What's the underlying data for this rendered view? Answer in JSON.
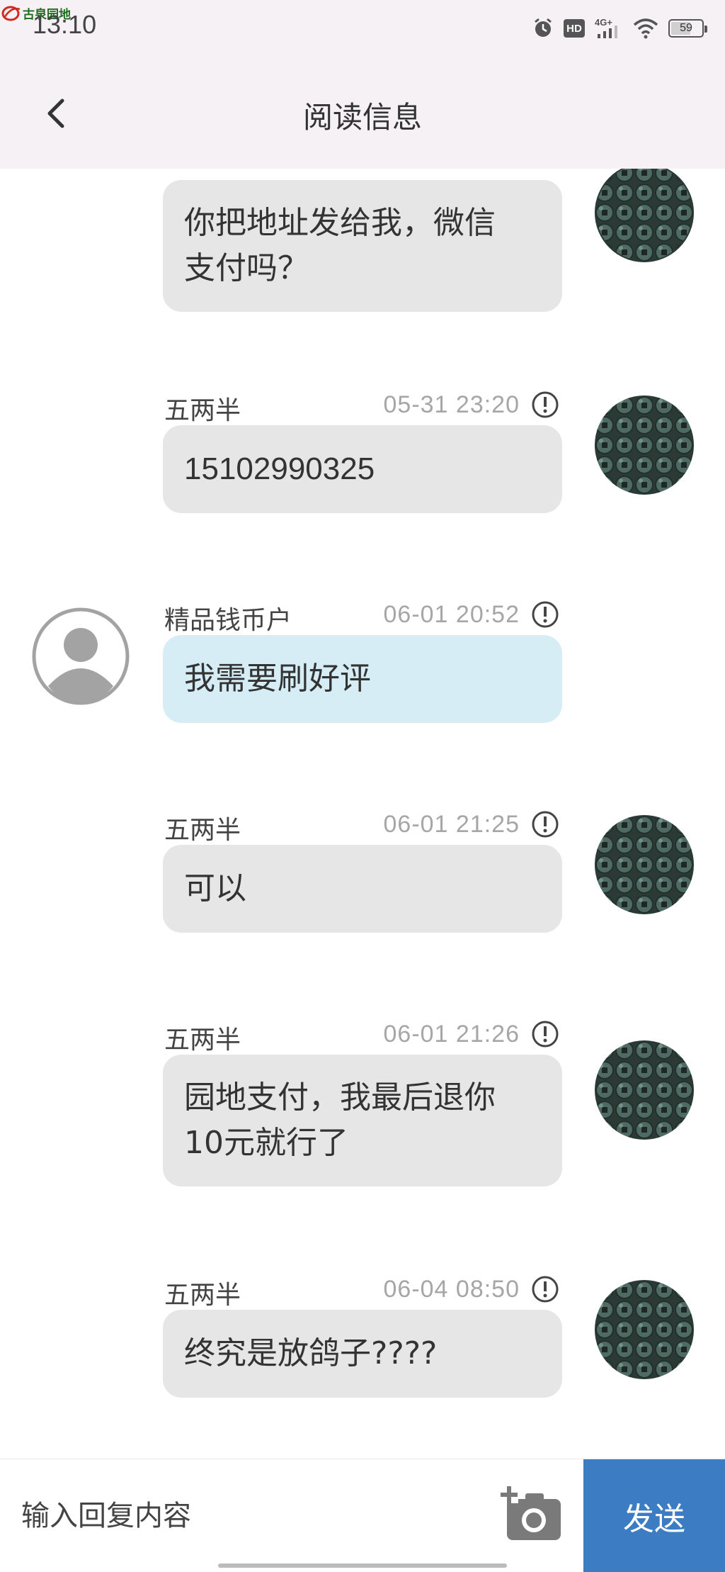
{
  "status_bar": {
    "app_logo_text": "古泉园地",
    "time": "13:10",
    "hd": "HD",
    "network": "4G+",
    "battery": "59"
  },
  "header": {
    "title": "阅读信息"
  },
  "messages": [
    {
      "name": "",
      "time": "",
      "text": "你把地址发给我，微信支付吗？",
      "line1": "你把地址发给我，微信",
      "line2": "支付吗？",
      "side": "self"
    },
    {
      "name": "五两半",
      "time": "05-31 23:20",
      "text": "15102990325",
      "side": "self"
    },
    {
      "name": "精品钱币户",
      "time": "06-01 20:52",
      "text": "我需要刷好评",
      "side": "other"
    },
    {
      "name": "五两半",
      "time": "06-01 21:25",
      "text": "可以",
      "side": "self"
    },
    {
      "name": "五两半",
      "time": "06-01 21:26",
      "line1": "园地支付，我最后退你",
      "line2": "10元就行了",
      "side": "self"
    },
    {
      "name": "五两半",
      "time": "06-04 08:50",
      "text": "终究是放鸽子????",
      "side": "self"
    }
  ],
  "composer": {
    "placeholder": "输入回复内容",
    "send_label": "发送"
  },
  "colors": {
    "header_bg": "#f6f1f5",
    "self_bubble": "#e6e6e6",
    "other_bubble": "#d6edf6",
    "send_button": "#3c7cc3"
  }
}
